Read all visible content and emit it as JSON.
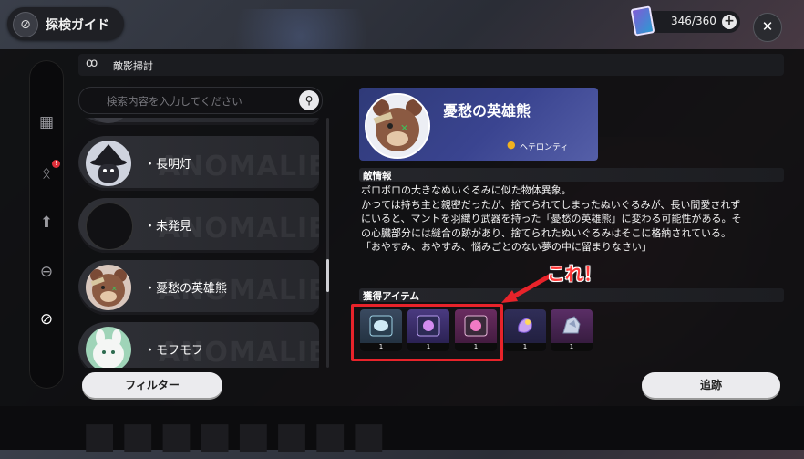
{
  "header": {
    "title": "探検ガイド",
    "resource_count": "346/360"
  },
  "section": {
    "title": "敵影掃討"
  },
  "search": {
    "placeholder": "検索内容を入力してください"
  },
  "list": {
    "items": [
      {
        "name": "・長明灯"
      },
      {
        "name": "・未発見"
      },
      {
        "name": "・憂愁の英雄熊"
      },
      {
        "name": "・モフモフ"
      }
    ],
    "watermark": "ANOMALIES"
  },
  "filter_label": "フィルター",
  "detail": {
    "name": "憂愁の英雄熊",
    "location": "ヘテロンティ",
    "info_title": "敵情報",
    "description": [
      "ボロボロの大きなぬいぐるみに似た物体異象。",
      "かつては持ち主と親密だったが、捨てられてしまったぬいぐるみが、長い間愛されず",
      "にいると、マントを羽織り武器を持った「憂愁の英雄熊」に変わる可能性がある。そ",
      "の心臓部分には縫合の跡があり、捨てられたぬいぐるみはそこに格納されている。",
      "「おやすみ、おやすみ、悩みごとのない夢の中に留まりなさい」"
    ],
    "items_title": "獲得アイテム",
    "items": [
      {
        "qty": "1"
      },
      {
        "qty": "1"
      },
      {
        "qty": "1"
      },
      {
        "qty": "1"
      },
      {
        "qty": "1"
      }
    ]
  },
  "annotation": "これ！",
  "track_label": "追跡",
  "colors": {
    "highlight": "#e8232a",
    "accent_pin": "#f1b21f",
    "hero_bg": "#3a4490"
  }
}
